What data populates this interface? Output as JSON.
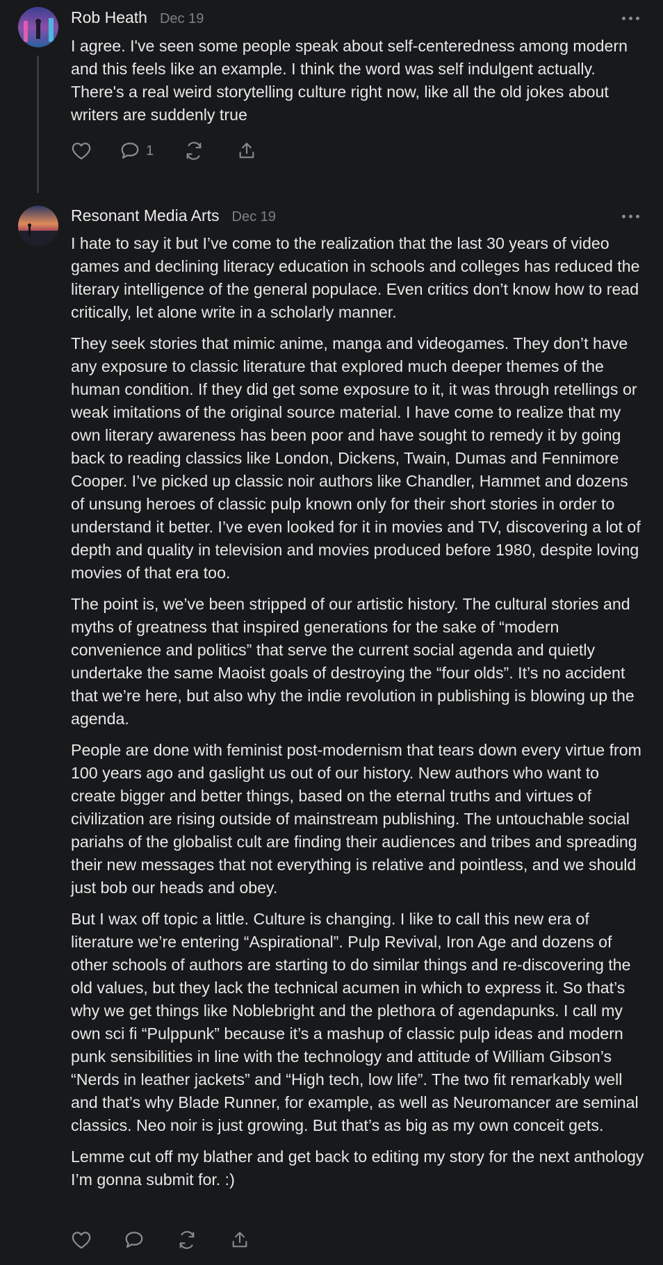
{
  "comments": [
    {
      "author": "Rob Heath",
      "date": "Dec 19",
      "paragraphs": [
        "I agree. I've seen some people speak about self-centeredness among modern and this feels like an example. I think the word was self indulgent actually. There's a real weird storytelling culture right now, like all the old jokes about writers are suddenly true"
      ],
      "reply_count": "1"
    },
    {
      "author": "Resonant Media Arts",
      "date": "Dec 19",
      "paragraphs": [
        "I hate to say it but I’ve come to the realization that the last 30 years of video games and declining literacy education in schools and colleges has reduced the literary intelligence of the general populace. Even critics don’t know how to read critically, let alone write in a scholarly manner.",
        "They seek stories that mimic anime, manga and videogames. They don’t have any exposure to classic literature that explored much deeper themes of the human condition. If they did get some exposure to it, it was through retellings or weak imitations of the original source material. I have come to realize that my own literary awareness has been poor and have sought to remedy it by going back to reading classics like London, Dickens, Twain, Dumas and Fennimore Cooper. I’ve picked up classic noir authors like Chandler, Hammet and dozens of unsung heroes of classic pulp known only for their short stories in order to understand it better. I’ve even looked for it in movies and TV, discovering a lot of depth and quality in television and movies produced before 1980, despite loving movies of that era too.",
        "The point is, we’ve been stripped of our artistic history. The cultural stories and myths of greatness that inspired generations for the sake of “modern convenience and politics” that serve the current social agenda and quietly undertake the same Maoist goals of destroying the “four olds”. It’s no accident that we’re here, but also why the indie revolution in publishing is blowing up the agenda.",
        "People are done with feminist post-modernism that tears down every virtue from 100 years ago and gaslight us out of our history. New authors who want to create bigger and better things, based on the eternal truths and virtues of civilization are rising outside of mainstream publishing. The untouchable social pariahs of the globalist cult are finding their audiences and tribes and spreading their new messages that not everything is relative and pointless, and we should just bob our heads and obey.",
        "But I wax off topic a little. Culture is changing. I like to call this new era of literature we’re entering “Aspirational”. Pulp Revival, Iron Age and dozens of other schools of authors are starting to do similar things and re-discovering the old values, but they lack the technical acumen in which to express it. So that’s why we get things like Noblebright and the plethora of agendapunks. I call my own sci fi “Pulppunk” because it’s a mashup of classic pulp ideas and modern punk sensibilities in line with the technology and attitude of William Gibson’s “Nerds in leather jackets” and “High tech, low life”. The two fit remarkably well and that’s why Blade Runner, for example, as well as Neuromancer are seminal classics. Neo noir is just growing. But that’s as big as my own conceit gets.",
        "Lemme cut off my blather and get back to editing my story for the next anthology I’m gonna submit for. :)"
      ],
      "reply_count": ""
    }
  ],
  "icons": [
    "heart-icon",
    "comment-icon",
    "restack-icon",
    "share-icon",
    "more-icon"
  ],
  "colors": {
    "background": "#18191b",
    "text": "#e8e8e8",
    "muted": "#808186"
  }
}
